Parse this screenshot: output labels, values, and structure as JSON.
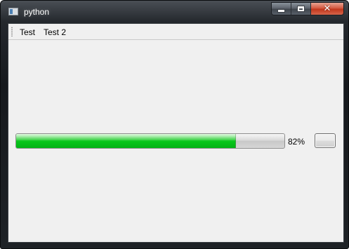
{
  "window": {
    "title": "python"
  },
  "menubar": {
    "items": [
      {
        "label": "Test"
      },
      {
        "label": "Test 2"
      }
    ]
  },
  "progress": {
    "value_percent": 82,
    "label": "82%",
    "fill_color": "#06c51a"
  },
  "button": {
    "label": ""
  },
  "icons": {
    "app": "window-icon",
    "minimize": "minimize-icon",
    "maximize": "maximize-icon",
    "close": "close-icon"
  }
}
